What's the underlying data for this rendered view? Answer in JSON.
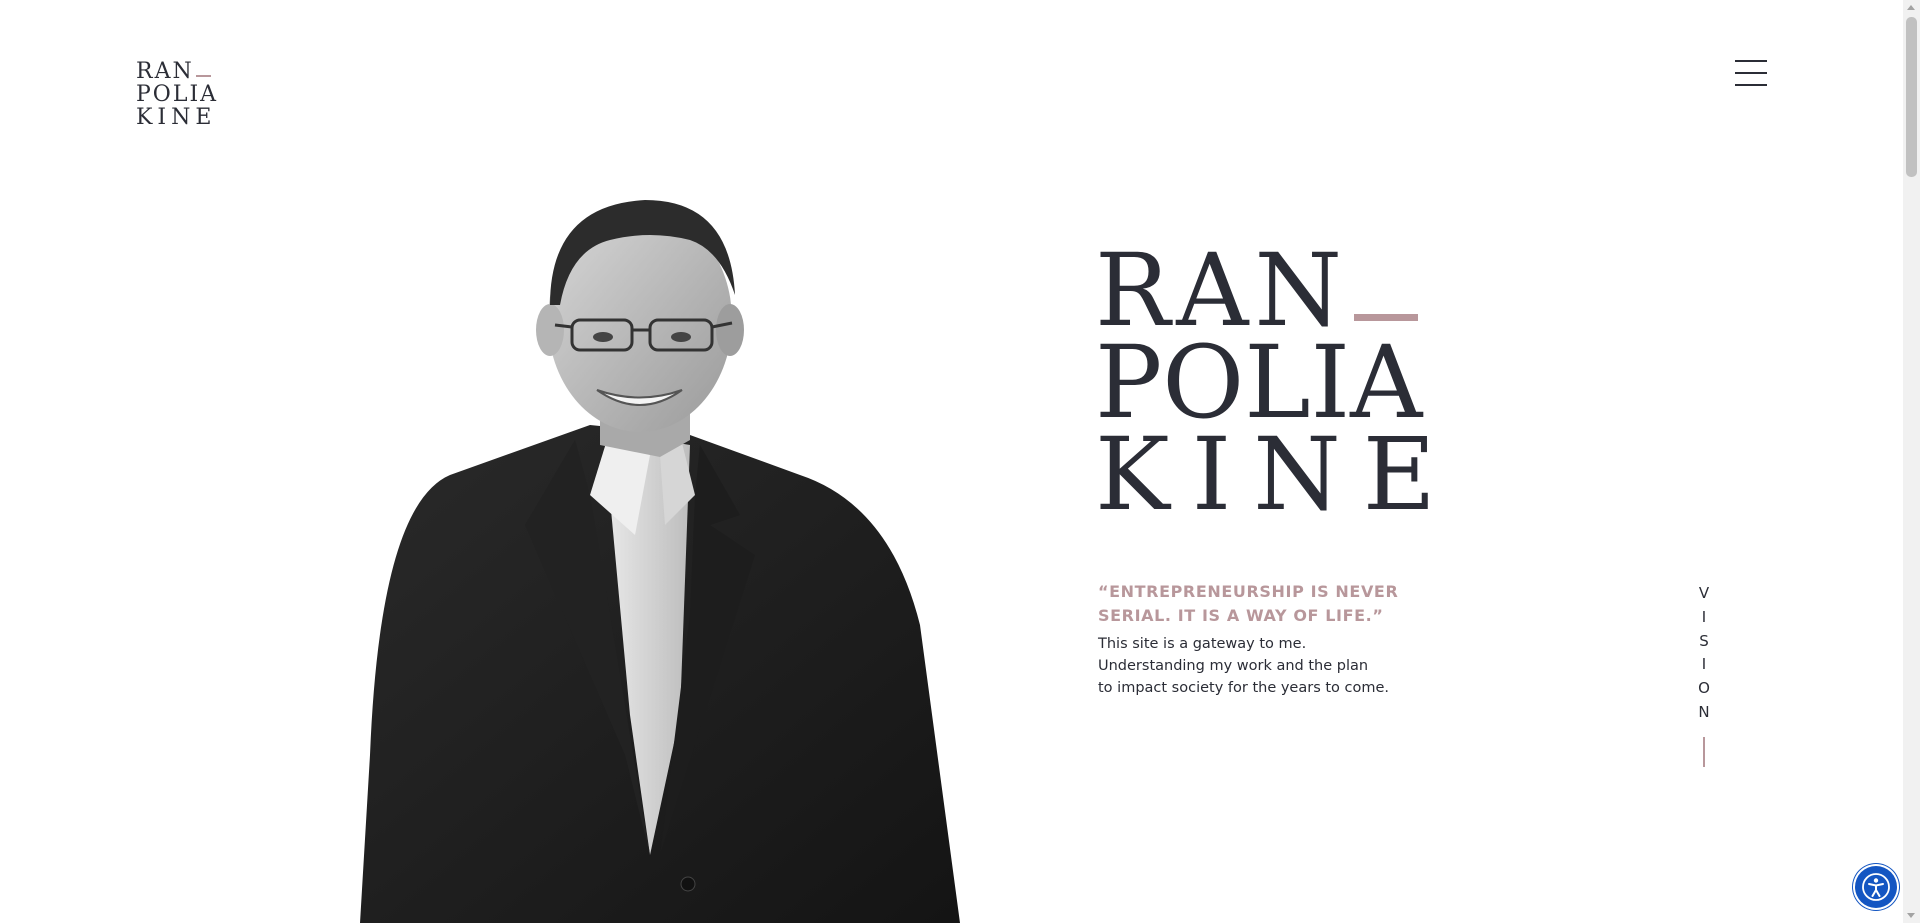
{
  "logo": {
    "line1": "RAN",
    "line2": "POLIA",
    "line3": "KINE"
  },
  "menu": {
    "icon": "hamburger-menu-icon"
  },
  "hero": {
    "name_line1": "RAN",
    "name_line2": "POLIA",
    "name_line3": "KINE",
    "quote": "“ENTREPRENEURSHIP IS NEVER SERIAL. IT IS A WAY OF LIFE.”",
    "intro_lines": [
      "This site is a gateway to me.",
      "Understanding my work and the plan",
      "to impact society for the years to come."
    ]
  },
  "vision_nav": {
    "letters": [
      "V",
      "I",
      "S",
      "I",
      "O",
      "N"
    ]
  },
  "accessibility": {
    "icon": "accessibility-icon"
  },
  "colors": {
    "accent": "#b8979b",
    "text": "#2b2d36",
    "background": "#ffffff",
    "a11y_button": "#1456c2"
  }
}
